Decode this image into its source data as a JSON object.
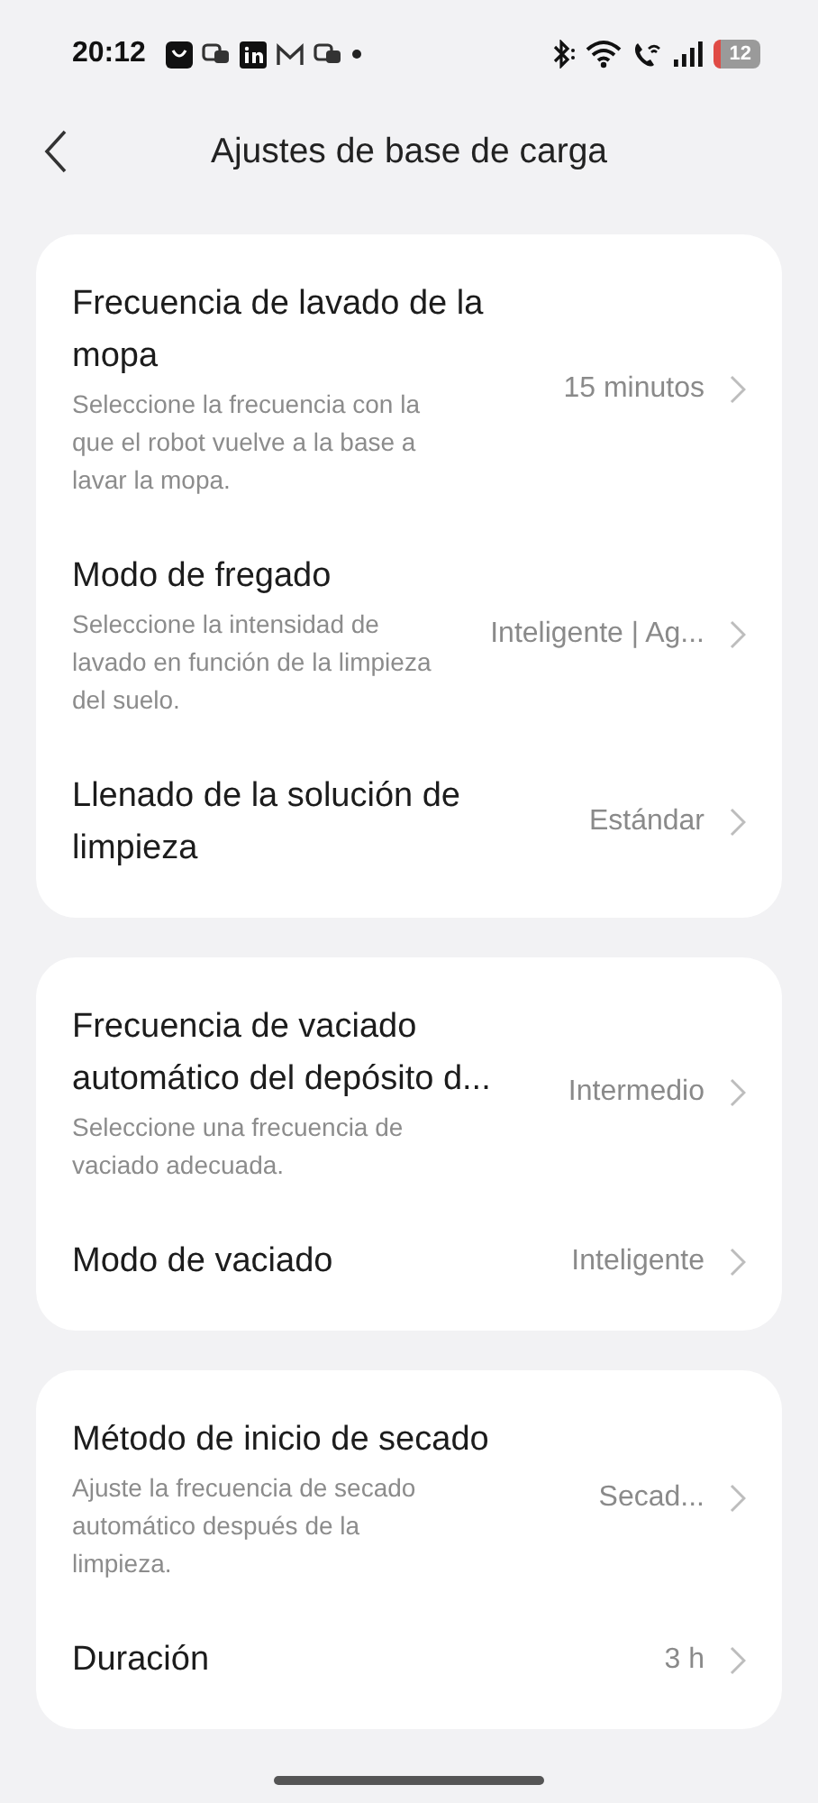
{
  "status_bar": {
    "time": "20:12",
    "battery": "12"
  },
  "header": {
    "title": "Ajustes de base de carga"
  },
  "cards": [
    {
      "rows": [
        {
          "title": "Frecuencia de lavado de la mopa",
          "description": "Seleccione la frecuencia con la que el robot vuelve a la base a lavar la mopa.",
          "value": "15 minutos"
        },
        {
          "title": "Modo de fregado",
          "description": "Seleccione la intensidad de lavado en función de la limpieza del suelo.",
          "value": "Inteligente | Ag..."
        },
        {
          "title": "Llenado de la solución de limpieza",
          "value": "Estándar"
        }
      ]
    },
    {
      "rows": [
        {
          "title": "Frecuencia de vaciado automático del depósito d...",
          "description": "Seleccione una frecuencia de vaciado adecuada.",
          "value": "Intermedio"
        },
        {
          "title": "Modo de vaciado",
          "value": "Inteligente"
        }
      ]
    },
    {
      "rows": [
        {
          "title": "Método de inicio de secado",
          "description": "Ajuste la frecuencia de secado automático después de la limpieza.",
          "value": "Secad..."
        },
        {
          "title": "Duración",
          "value": "3 h"
        }
      ]
    }
  ]
}
